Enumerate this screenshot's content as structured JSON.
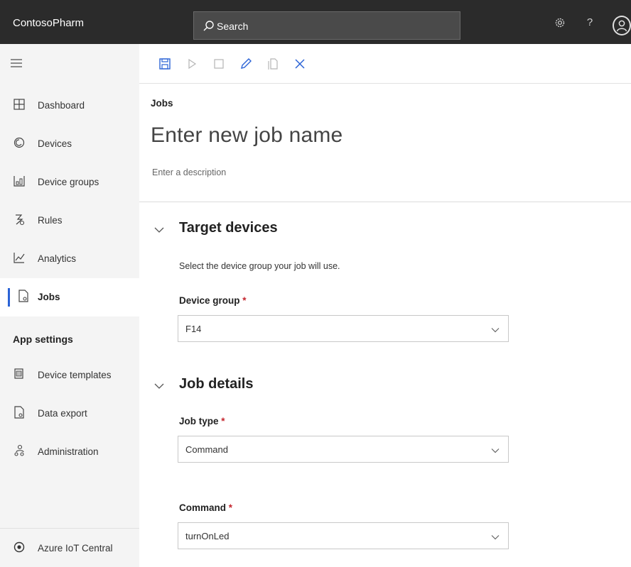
{
  "app": {
    "name": "ContosoPharm"
  },
  "search": {
    "placeholder": "Search"
  },
  "sidebar": {
    "items": [
      {
        "label": "Dashboard"
      },
      {
        "label": "Devices"
      },
      {
        "label": "Device groups"
      },
      {
        "label": "Rules"
      },
      {
        "label": "Analytics"
      },
      {
        "label": "Jobs"
      }
    ],
    "settings_heading": "App settings",
    "settings_items": [
      {
        "label": "Device templates"
      },
      {
        "label": "Data export"
      },
      {
        "label": "Administration"
      }
    ],
    "footer_label": "Azure IoT Central"
  },
  "page": {
    "breadcrumb": "Jobs",
    "name_placeholder": "Enter new job name",
    "description_placeholder": "Enter a description"
  },
  "target_devices": {
    "title": "Target devices",
    "description": "Select the device group your job will use.",
    "device_group_label": "Device group",
    "device_group_value": "F14"
  },
  "job_details": {
    "title": "Job details",
    "job_type_label": "Job type",
    "job_type_value": "Command",
    "command_label": "Command",
    "command_value": "turnOnLed"
  },
  "required_marker": "*",
  "colors": {
    "topbar": "#2b2b2b",
    "accent": "#2b63d6",
    "required": "#c4262e",
    "sidebar_bg": "#f4f4f4"
  },
  "icons": {
    "toolbar": [
      "save-icon",
      "run-icon",
      "stop-icon",
      "edit-icon",
      "copy-icon",
      "close-icon"
    ]
  }
}
